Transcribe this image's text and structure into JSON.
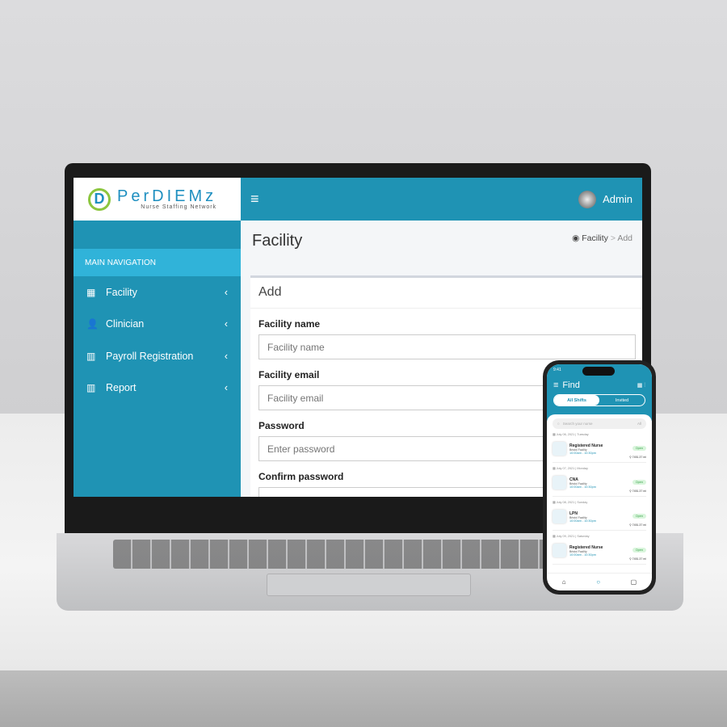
{
  "app": {
    "brand": "PerDIEMz",
    "tagline": "Nurse Staffing Network",
    "user": "Admin",
    "accent": "#1f93b4"
  },
  "sidebar": {
    "header": "MAIN NAVIGATION",
    "items": [
      {
        "label": "Facility",
        "icon": "hospital-icon"
      },
      {
        "label": "Clinician",
        "icon": "user-doctor-icon"
      },
      {
        "label": "Payroll Registration",
        "icon": "building-icon"
      },
      {
        "label": "Report",
        "icon": "building-icon"
      }
    ]
  },
  "page": {
    "title": "Facility",
    "breadcrumb": [
      "Facility",
      "Add"
    ]
  },
  "form": {
    "title": "Add",
    "fields": [
      {
        "label": "Facility name",
        "placeholder": "Facility name"
      },
      {
        "label": "Facility email",
        "placeholder": "Facility email"
      },
      {
        "label": "Password",
        "placeholder": "Enter password"
      },
      {
        "label": "Confirm password",
        "placeholder": ""
      }
    ]
  },
  "phone": {
    "time": "9:41",
    "title": "Find",
    "tabs": [
      "All Shifts",
      "Invited"
    ],
    "search_placeholder": "Search your nurse",
    "filter": "All",
    "shifts": [
      {
        "date": "July 06, 2021",
        "day": "Tuesday",
        "role": "Registered Nurse",
        "facility": "Bristol Facility",
        "hours": "10:00am - 10:30pm",
        "status": "Open",
        "distance": "7451.37 mi"
      },
      {
        "date": "July 07, 2021",
        "day": "Monday",
        "role": "CNA",
        "facility": "Bristol Facility",
        "hours": "10:00am - 10:30pm",
        "status": "Open",
        "distance": "7451.37 mi"
      },
      {
        "date": "July 08, 2021",
        "day": "Sunday",
        "role": "LPN",
        "facility": "Bristol Facility",
        "hours": "10:00am - 10:30pm",
        "status": "Open",
        "distance": "7451.37 mi"
      },
      {
        "date": "July 09, 2021",
        "day": "Saturday",
        "role": "Registered Nurse",
        "facility": "Bristol Facility",
        "hours": "10:00am - 10:30pm",
        "status": "Open",
        "distance": "7451.37 mi"
      }
    ]
  }
}
